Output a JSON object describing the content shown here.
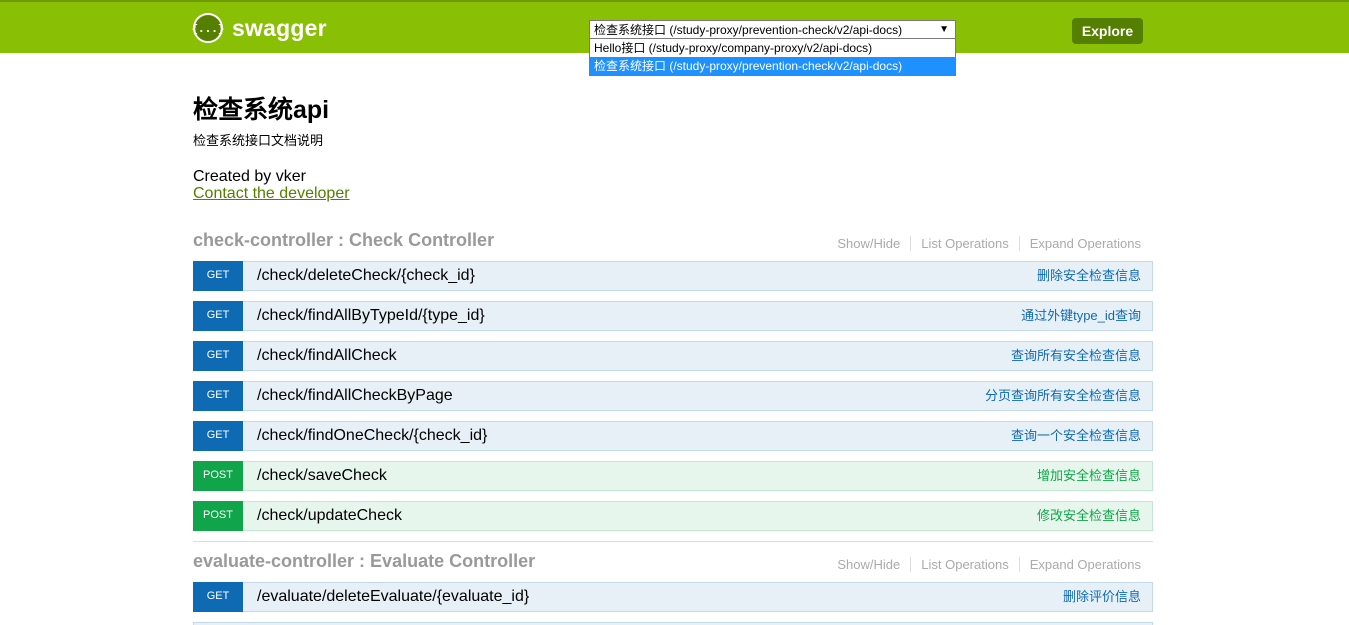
{
  "header": {
    "logo_icon": "{...}",
    "logo_text": "swagger",
    "select_value": "检查系统接口 (/study-proxy/prevention-check/v2/api-docs)",
    "dropdown_options": [
      "Hello接口 (/study-proxy/company-proxy/v2/api-docs)",
      "检查系统接口 (/study-proxy/prevention-check/v2/api-docs)"
    ],
    "explore_label": "Explore",
    "header_color": "#89bf04"
  },
  "info": {
    "title": "检查系统api",
    "description": "检查系统接口文档说明",
    "created_by": "Created by vker",
    "contact": "Contact the developer"
  },
  "resources": [
    {
      "title": "check-controller : Check Controller",
      "links": [
        "Show/Hide",
        "List Operations",
        "Expand Operations"
      ],
      "operations": [
        {
          "method": "GET",
          "path": "/check/deleteCheck/{check_id}",
          "summary": "删除安全检查信息"
        },
        {
          "method": "GET",
          "path": "/check/findAllByTypeId/{type_id}",
          "summary": "通过外键type_id查询"
        },
        {
          "method": "GET",
          "path": "/check/findAllCheck",
          "summary": "查询所有安全检查信息"
        },
        {
          "method": "GET",
          "path": "/check/findAllCheckByPage",
          "summary": "分页查询所有安全检查信息"
        },
        {
          "method": "GET",
          "path": "/check/findOneCheck/{check_id}",
          "summary": "查询一个安全检查信息"
        },
        {
          "method": "POST",
          "path": "/check/saveCheck",
          "summary": "增加安全检查信息"
        },
        {
          "method": "POST",
          "path": "/check/updateCheck",
          "summary": "修改安全检查信息"
        }
      ]
    },
    {
      "title": "evaluate-controller : Evaluate Controller",
      "links": [
        "Show/Hide",
        "List Operations",
        "Expand Operations"
      ],
      "operations": [
        {
          "method": "GET",
          "path": "/evaluate/deleteEvaluate/{evaluate_id}",
          "summary": "删除评价信息"
        }
      ]
    }
  ]
}
